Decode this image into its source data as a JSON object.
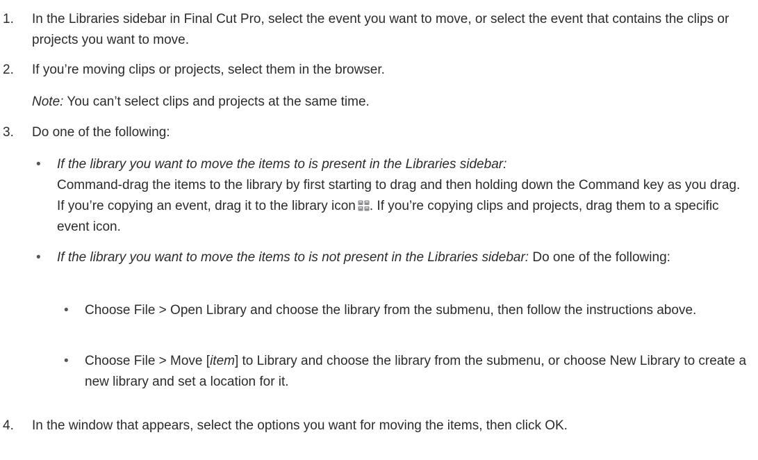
{
  "steps": [
    {
      "num": "1.",
      "text": "In the Libraries sidebar in Final Cut Pro, select the event you want to move, or select the event that contains the clips or projects you want to move."
    },
    {
      "num": "2.",
      "text": "If you’re moving clips or projects, select them in the browser.",
      "note_label": "Note:",
      "note_text": " You can’t select clips and projects at the same time."
    },
    {
      "num": "3.",
      "text": "Do one of the following:",
      "bullets": [
        {
          "italic": "If the library you want to move the items to is present in the Libraries sidebar:",
          "line1_after": "",
          "text_a": "Command-drag the items to the library by first starting to drag and then holding down the Command key as you drag. If you’re copying an event, drag it to the library icon",
          "text_b": ". If you’re copying clips and projects, drag them to a specific event icon."
        },
        {
          "italic": "If the library you want to move the items to is not present in the Libraries sidebar:",
          "text": " Do one of the following:",
          "sub_bullets": [
            "Choose File > Open Library and choose the library from the submenu, then follow the instructions above.",
            {
              "pre": "Choose File > Move [",
              "italic": "item",
              "post": "] to Library and choose the library from the submenu, or choose New Library to create a new library and set a location for it."
            }
          ]
        }
      ]
    },
    {
      "num": "4.",
      "text": "In the window that appears, select the options you want for moving the items, then click OK."
    }
  ],
  "bullet_glyph": "•",
  "icon": "library-icon"
}
